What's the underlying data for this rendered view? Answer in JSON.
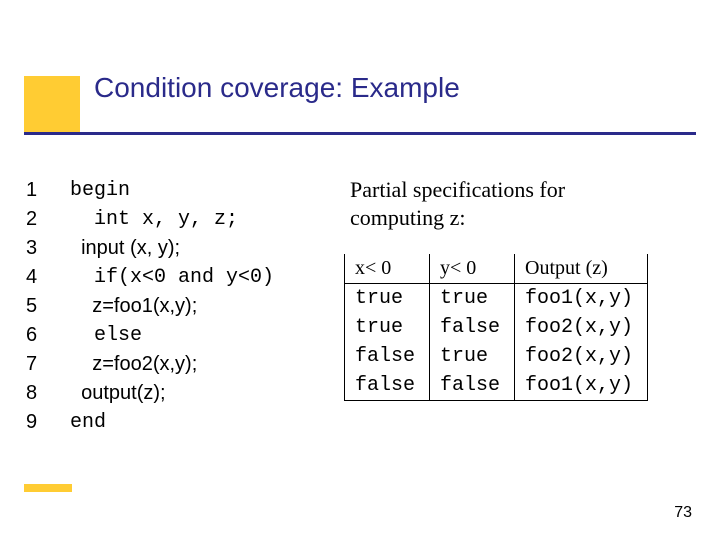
{
  "title": "Condition coverage: Example",
  "code": {
    "lines": [
      {
        "n": "1",
        "text": "begin"
      },
      {
        "n": "2",
        "text": "  int x, y, z;"
      },
      {
        "n": "3",
        "text": "  input (x, y);"
      },
      {
        "n": "4",
        "text": "  if(x<0 and y<0)"
      },
      {
        "n": "5",
        "text": "    z=foo1(x,y);"
      },
      {
        "n": "6",
        "text": "  else"
      },
      {
        "n": "7",
        "text": "    z=foo2(x,y);"
      },
      {
        "n": "8",
        "text": "  output(z);"
      },
      {
        "n": "9",
        "text": "end"
      }
    ]
  },
  "caption_line1": "Partial specifications for",
  "caption_line2": "computing z:",
  "chart_data": {
    "type": "table",
    "columns": [
      "x< 0",
      "y< 0",
      "Output (z)"
    ],
    "rows": [
      [
        "true",
        "true",
        "foo1(x,y)"
      ],
      [
        "true",
        "false",
        "foo2(x,y)"
      ],
      [
        "false",
        "true",
        "foo2(x,y)"
      ],
      [
        "false",
        "false",
        "foo1(x,y)"
      ]
    ]
  },
  "page_number": "73"
}
